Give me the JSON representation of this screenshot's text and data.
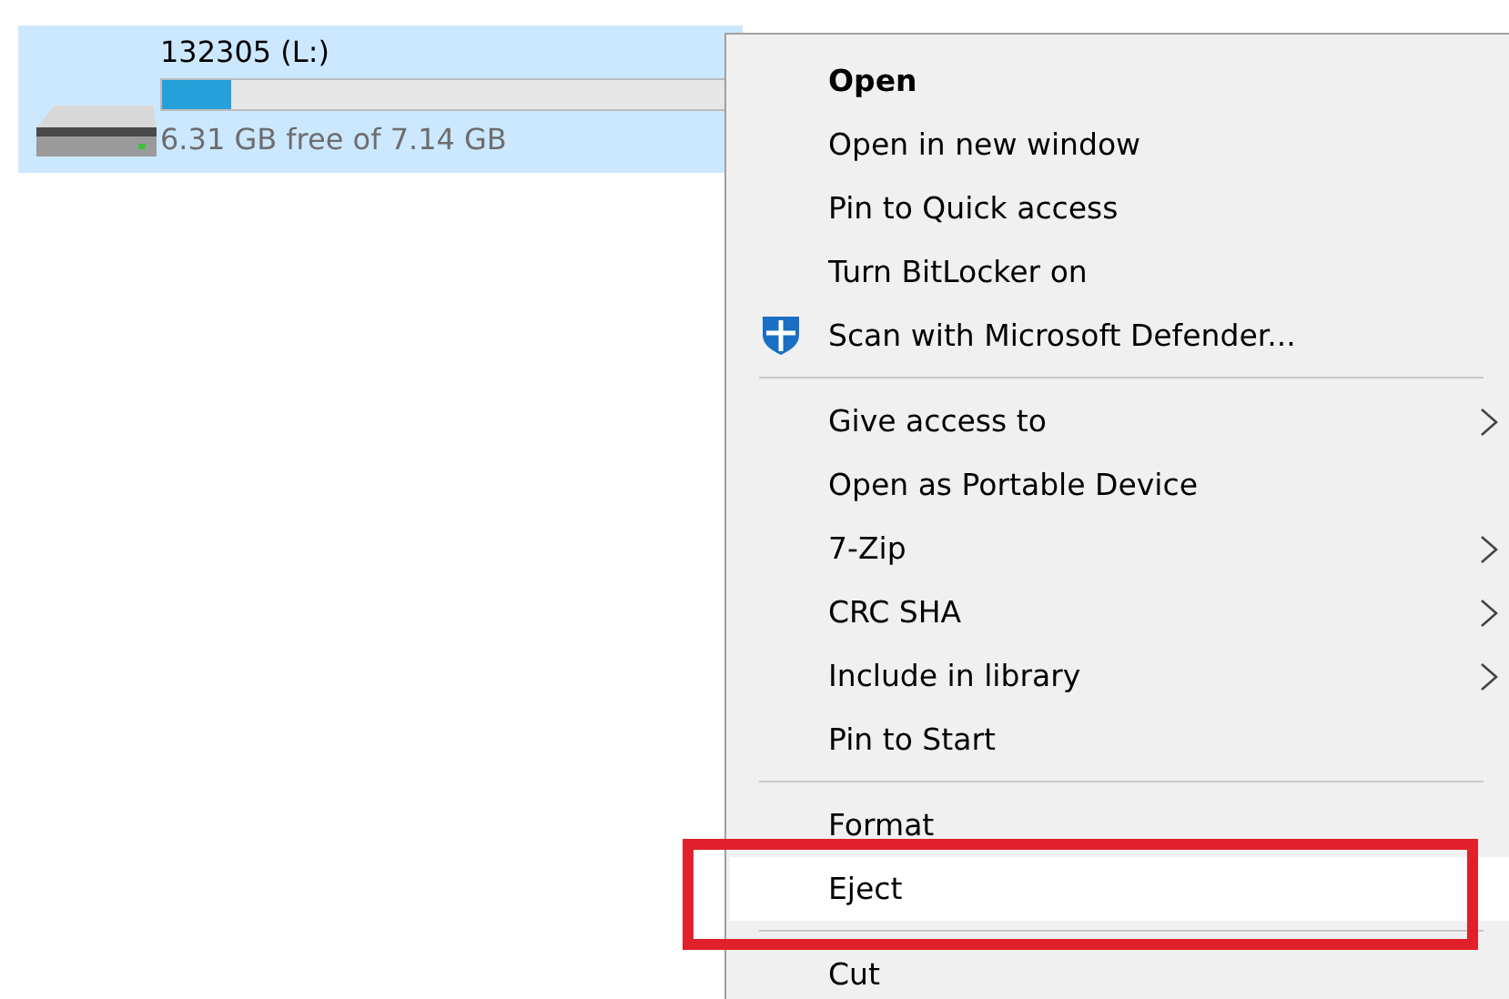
{
  "drive": {
    "label": "132305 (L:)",
    "level": 0.12,
    "caption": "6.31 GB free of 7.14 GB",
    "selected": true
  },
  "context_menu": {
    "items": [
      {
        "kind": "default",
        "label": "Open",
        "submenu": false,
        "selected": false
      },
      {
        "kind": "item",
        "label": "Open in new window",
        "submenu": false,
        "selected": false
      },
      {
        "kind": "item",
        "label": "Pin to Quick access",
        "submenu": false,
        "selected": false
      },
      {
        "kind": "item",
        "label": "Turn BitLocker on",
        "submenu": false,
        "selected": false
      },
      {
        "kind": "icon-item",
        "label": "Scan with Microsoft Defender...",
        "submenu": false,
        "selected": false
      },
      {
        "kind": "separator"
      },
      {
        "kind": "item",
        "label": "Give access to",
        "submenu": true,
        "selected": false
      },
      {
        "kind": "item",
        "label": "Open as Portable Device",
        "submenu": false,
        "selected": false
      },
      {
        "kind": "item",
        "label": "7-Zip",
        "submenu": true,
        "selected": false
      },
      {
        "kind": "item",
        "label": "CRC SHA",
        "submenu": true,
        "selected": false
      },
      {
        "kind": "item",
        "label": "Include in library",
        "submenu": true,
        "selected": false
      },
      {
        "kind": "item",
        "label": "Pin to Start",
        "submenu": false,
        "selected": false
      },
      {
        "kind": "separator"
      },
      {
        "kind": "item",
        "label": "Format",
        "submenu": false,
        "selected": false
      },
      {
        "kind": "item",
        "label": "Eject",
        "submenu": false,
        "selected": true
      },
      {
        "kind": "separator"
      },
      {
        "kind": "item",
        "label": "Cut",
        "submenu": false,
        "selected": false
      }
    ]
  }
}
